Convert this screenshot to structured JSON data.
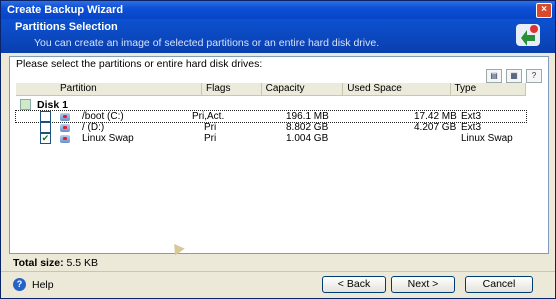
{
  "window": {
    "title": "Create Backup Wizard",
    "close_glyph": "×"
  },
  "header": {
    "title": "Partitions Selection",
    "subtitle": "You can create an image of selected partitions or an entire hard disk drive."
  },
  "prompt": "Please select the partitions or entire hard disk drives:",
  "toolbar": {
    "icons": [
      "details-view-icon",
      "properties-icon",
      "help-icon-small"
    ]
  },
  "table": {
    "columns": [
      "Partition",
      "Flags",
      "Capacity",
      "Used Space",
      "Type"
    ],
    "disk_label": "Disk 1",
    "rows": [
      {
        "checked": false,
        "partition": "/boot (C:)",
        "flags": "Pri,Act.",
        "capacity": "196.1 MB",
        "used": "17.42 MB",
        "type": "Ext3"
      },
      {
        "checked": false,
        "partition": "/ (D:)",
        "flags": "Pri",
        "capacity": "8.802 GB",
        "used": "4.207 GB",
        "type": "Ext3"
      },
      {
        "checked": true,
        "partition": "Linux Swap",
        "flags": "Pri",
        "capacity": "1.004 GB",
        "used": "",
        "type": "Linux Swap"
      }
    ]
  },
  "footer": {
    "total_label": "Total size:",
    "total_value": "5.5 KB",
    "help_label": "Help",
    "back_label": "< Back",
    "next_label": "Next >",
    "cancel_label": "Cancel"
  }
}
